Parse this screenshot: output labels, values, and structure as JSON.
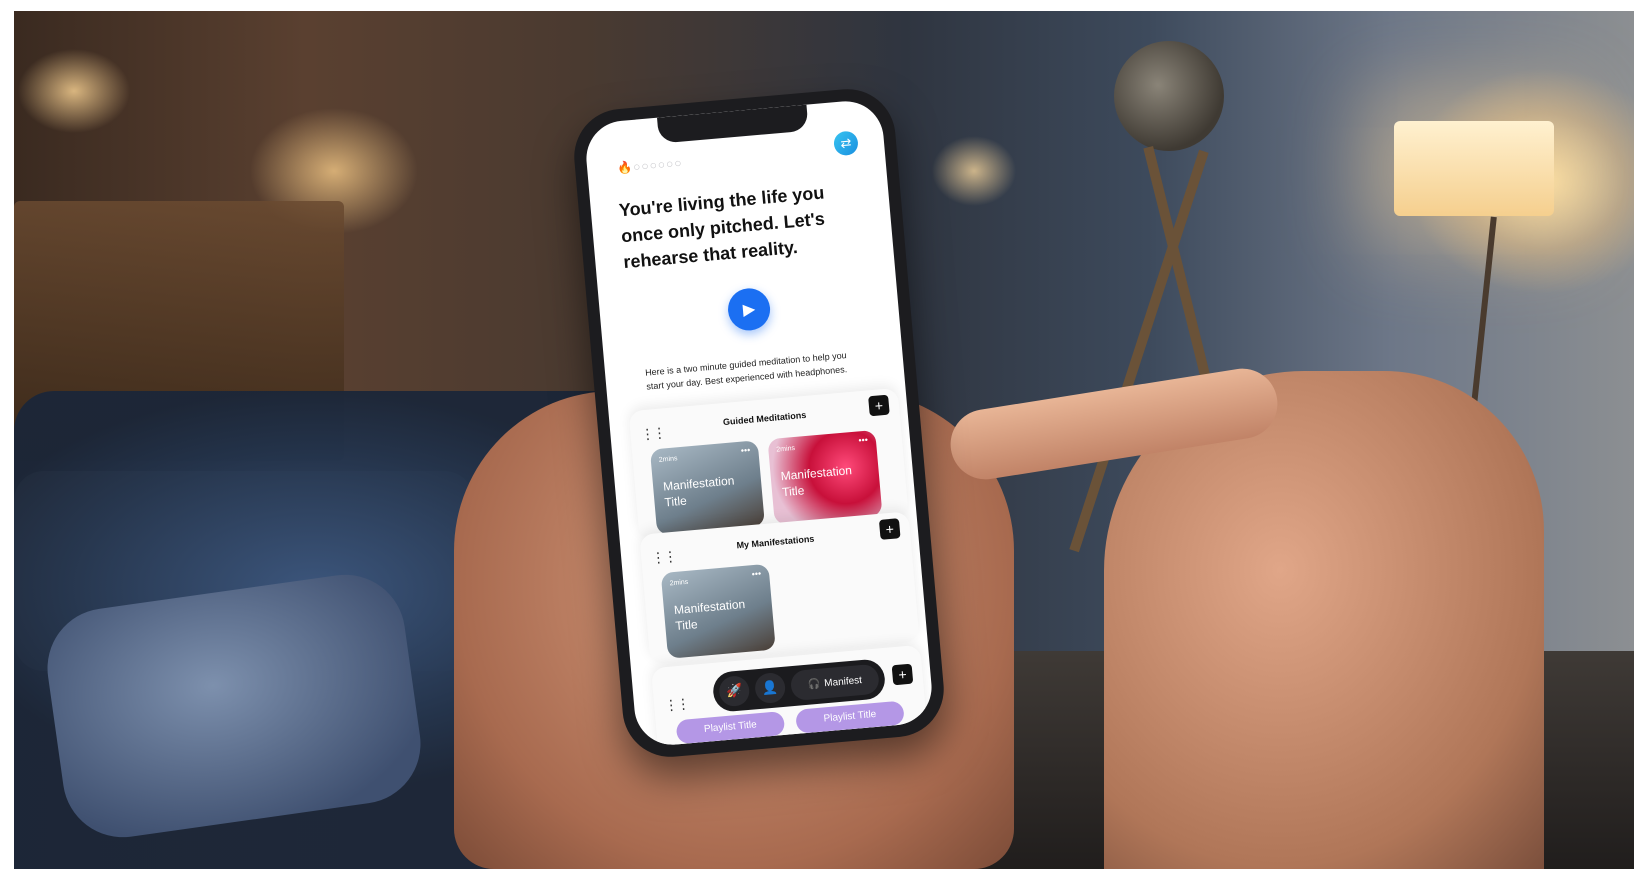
{
  "streak": {
    "fire_icon": "fire-icon",
    "dots": "○○○○○○"
  },
  "headline": "You're living the life you once only pitched. Let's rehearse that reality.",
  "play_icon": "▶",
  "description": "Here is a two minute guided meditation to help you start your day. Best experienced with headphones.",
  "sections": {
    "guided": {
      "title": "Guided Meditations",
      "add": "+",
      "cards": [
        {
          "duration": "2mins",
          "title": "Manifestation Title",
          "more": "•••"
        },
        {
          "duration": "2mins",
          "title": "Manifestation Title",
          "more": "•••"
        }
      ]
    },
    "mine": {
      "title": "My Manifestations",
      "add": "+",
      "cards": [
        {
          "duration": "2mins",
          "title": "Manifestation Title",
          "more": "•••"
        }
      ]
    },
    "playlists": {
      "add": "+",
      "items": [
        "Playlist Title",
        "Playlist Title"
      ]
    }
  },
  "bottom_nav": {
    "rocket_icon": "🚀",
    "person_icon": "👤",
    "manifest_label": "Manifest",
    "headphones_icon": "🎧"
  },
  "colors": {
    "accent_blue": "#1b6ff2",
    "playlist_purple": "#b497e6",
    "fire_orange": "#f07a2a"
  }
}
